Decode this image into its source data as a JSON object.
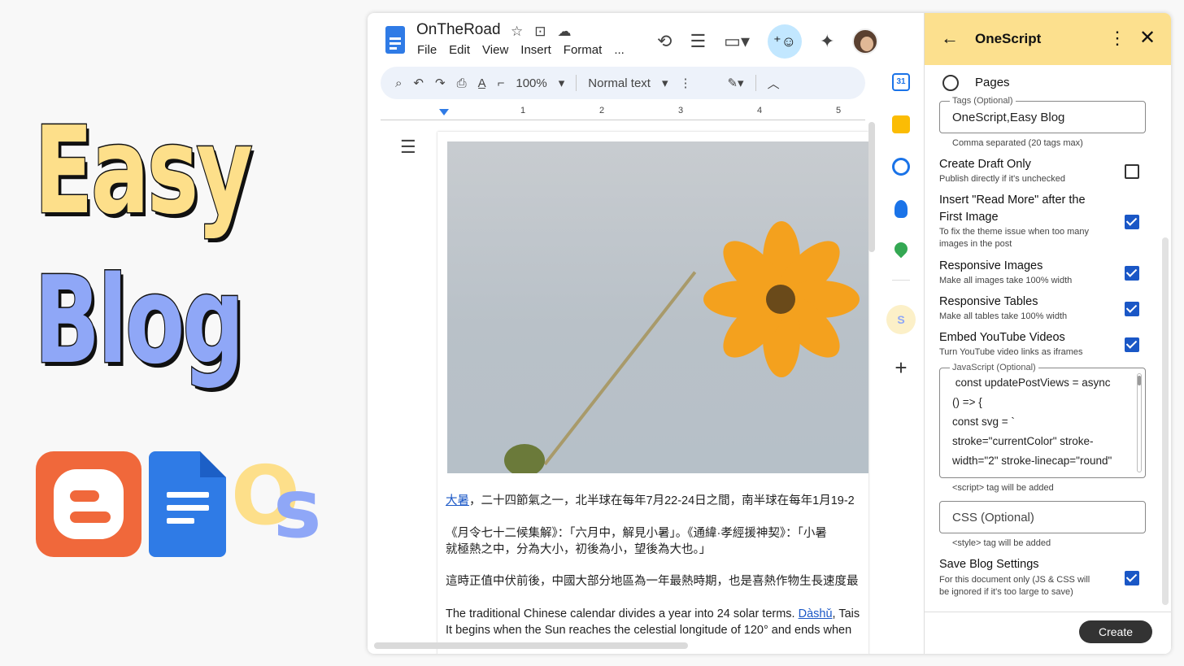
{
  "promo": {
    "word1": "Easy",
    "word2": "Blog",
    "logos": [
      "blogger-logo",
      "google-docs-logo",
      "onescript-os-logo"
    ],
    "os_o": "O",
    "os_s": "s"
  },
  "colors": {
    "promo_yellow": "#fddf8a",
    "promo_blue": "#8fa7f7",
    "blogger_orange": "#f0683b",
    "docs_blue": "#2f7be6",
    "panel_header": "#fce08e",
    "checkbox_blue": "#1a57c6"
  },
  "doc": {
    "title": "OnTheRoad",
    "menu": [
      "File",
      "Edit",
      "View",
      "Insert",
      "Format",
      "..."
    ],
    "toolbar": {
      "zoom": "100%",
      "style": "Normal text"
    },
    "ruler": [
      "1",
      "2",
      "3",
      "4",
      "5"
    ],
    "paragraphs": {
      "p1_link": "大暑",
      "p1_rest": "，二十四節氣之一，北半球在每年7月22-24日之間，南半球在每年1月19-2",
      "p2_line1": "《月令七十二候集解》：「六月中，解見小暑」。《通緯·孝經援神契》：「小暑",
      "p2_line2": "就極熱之中，分為大小，初後為小，望後為大也。」",
      "p3": "這時正值中伏前後，中國大部分地區為一年最熱時期，也是喜熱作物生長速度最",
      "p4_before": "The traditional Chinese calendar divides a year into 24 solar terms. ",
      "p4_link": "Dàshǔ",
      "p4_after": ", Tais",
      "p4_line2": "It begins when the Sun reaches the celestial longitude of 120° and ends when"
    }
  },
  "panel": {
    "title": "OneScript",
    "pages_label": "Pages",
    "tags_legend": "Tags (Optional)",
    "tags_value": "OneScript,Easy Blog",
    "tags_helper": "Comma separated (20 tags max)",
    "options": [
      {
        "title": "Create Draft Only",
        "desc": "Publish directly if it's unchecked",
        "checked": false
      },
      {
        "title_line1": "Insert \"Read More\" after the",
        "title_line2": "First Image",
        "desc_line1": "To fix the theme issue when too many",
        "desc_line2": "images in the post",
        "checked": true
      },
      {
        "title": "Responsive Images",
        "desc": "Make all images take 100% width",
        "checked": true
      },
      {
        "title": "Responsive Tables",
        "desc": "Make all tables take 100% width",
        "checked": true
      },
      {
        "title": "Embed YouTube Videos",
        "desc": "Turn YouTube video links as iframes",
        "checked": true
      }
    ],
    "js_legend": "JavaScript (Optional)",
    "js_lines": [
      " const updatePostViews = async",
      "() => {",
      "const svg = `",
      "stroke=\"currentColor\" stroke-",
      "width=\"2\" stroke-linecap=\"round\""
    ],
    "js_helper": "<script> tag will be added",
    "css_placeholder": "CSS (Optional)",
    "css_helper": "<style> tag will be added",
    "save": {
      "title": "Save Blog Settings",
      "desc_line1": "For this document only (JS & CSS will",
      "desc_line2": "be ignored if it's too large to save)",
      "checked": true
    },
    "create_label": "Create"
  },
  "rail": {
    "calendar_day": "31",
    "os_label": "S"
  }
}
